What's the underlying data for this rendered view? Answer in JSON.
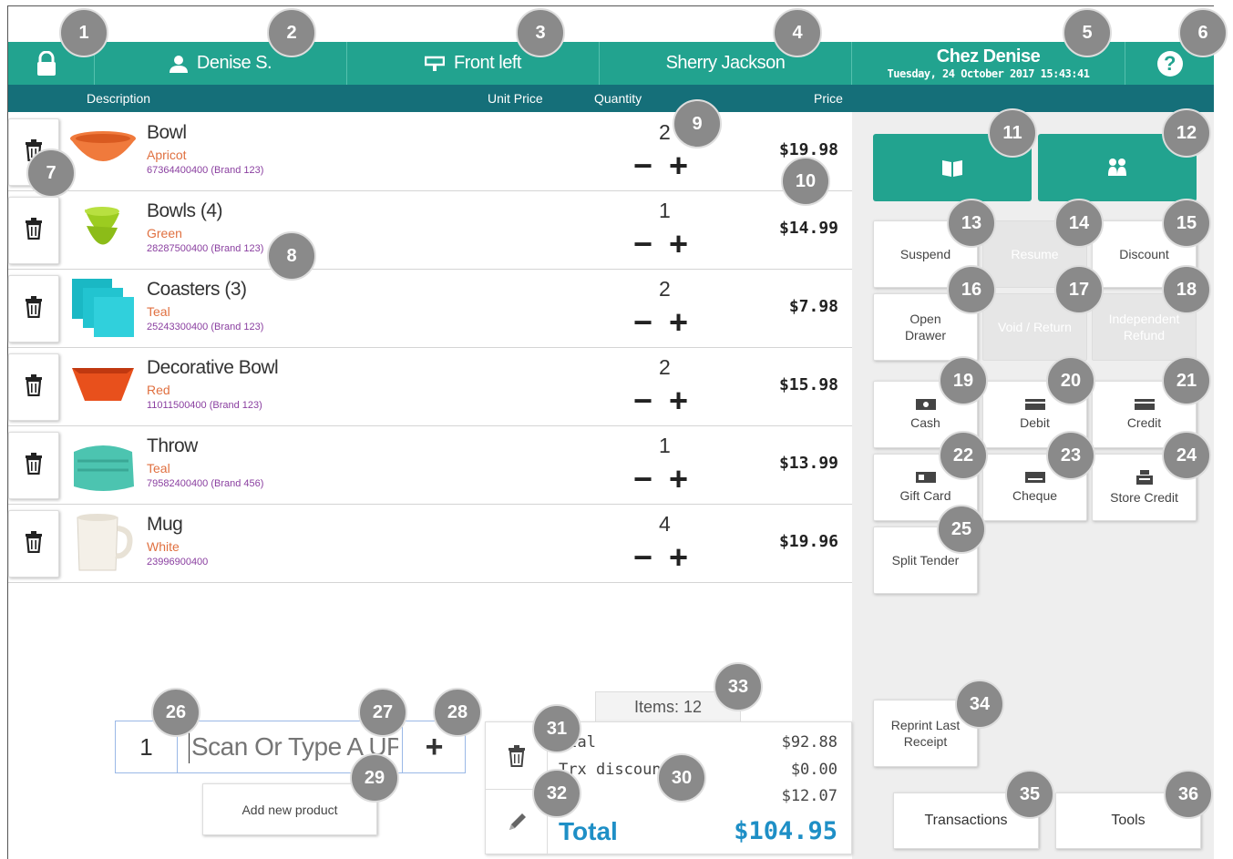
{
  "header": {
    "user": "Denise S.",
    "register": "Front left",
    "customer": "Sherry Jackson",
    "store_name": "Chez Denise",
    "datetime": "Tuesday, 24 October 2017 15:43:41",
    "help_glyph": "?"
  },
  "columns": {
    "description": "Description",
    "unit_price": "Unit Price",
    "quantity": "Quantity",
    "price": "Price"
  },
  "cart": [
    {
      "name": "Bowl",
      "variant": "Apricot",
      "upc": "67364400400 (Brand 123)",
      "qty": "2",
      "price": "$19.98",
      "thumb": "bowl-orange"
    },
    {
      "name": "Bowls (4)",
      "variant": "Green",
      "upc": "28287500400 (Brand 123)",
      "qty": "1",
      "price": "$14.99",
      "thumb": "bowls-green"
    },
    {
      "name": "Coasters (3)",
      "variant": "Teal",
      "upc": "25243300400 (Brand 123)",
      "qty": "2",
      "price": "$7.98",
      "thumb": "coasters-teal"
    },
    {
      "name": "Decorative Bowl",
      "variant": "Red",
      "upc": "11011500400 (Brand 123)",
      "qty": "2",
      "price": "$15.98",
      "thumb": "bowl-red"
    },
    {
      "name": "Throw",
      "variant": "Teal",
      "upc": "79582400400 (Brand 456)",
      "qty": "1",
      "price": "$13.99",
      "thumb": "throw-teal"
    },
    {
      "name": "Mug",
      "variant": "White",
      "upc": "23996900400",
      "qty": "4",
      "price": "$19.96",
      "thumb": "mug-white"
    }
  ],
  "qty_controls": {
    "minus": "−",
    "plus": "+"
  },
  "actions": {
    "suspend": "Suspend",
    "resume": "Resume",
    "discount": "Discount",
    "open_drawer": "Open Drawer",
    "void_return": "Void / Return",
    "independent_refund": "Independent Refund",
    "cash": "Cash",
    "debit": "Debit",
    "credit": "Credit",
    "gift_card": "Gift Card",
    "cheque": "Cheque",
    "store_credit": "Store Credit",
    "split_tender": "Split Tender",
    "reprint": "Reprint Last Receipt"
  },
  "scan": {
    "qty": "1",
    "placeholder": "Scan Or Type A UPC",
    "plus": "+",
    "add_new": "Add new product"
  },
  "summary": {
    "items": "Items: 12",
    "subtotal_label": "otal",
    "subtotal": "$92.88",
    "discount_label": "Trx discount",
    "discount": "$0.00",
    "tax": "$12.07",
    "total_label": "Total",
    "total": "$104.95"
  },
  "tabs": {
    "transactions": "Transactions",
    "tools": "Tools"
  },
  "badges": [
    "1",
    "2",
    "3",
    "4",
    "5",
    "6",
    "7",
    "8",
    "9",
    "10",
    "11",
    "12",
    "13",
    "14",
    "15",
    "16",
    "17",
    "18",
    "19",
    "20",
    "21",
    "22",
    "23",
    "24",
    "25",
    "26",
    "27",
    "28",
    "29",
    "30",
    "31",
    "32",
    "33",
    "34",
    "35",
    "36"
  ],
  "colors": {
    "teal": "#22a38f",
    "dark_teal": "#156f79",
    "total_blue": "#1e8fc6",
    "variant_orange": "#e07040",
    "upc_purple": "#8a3fa0"
  }
}
